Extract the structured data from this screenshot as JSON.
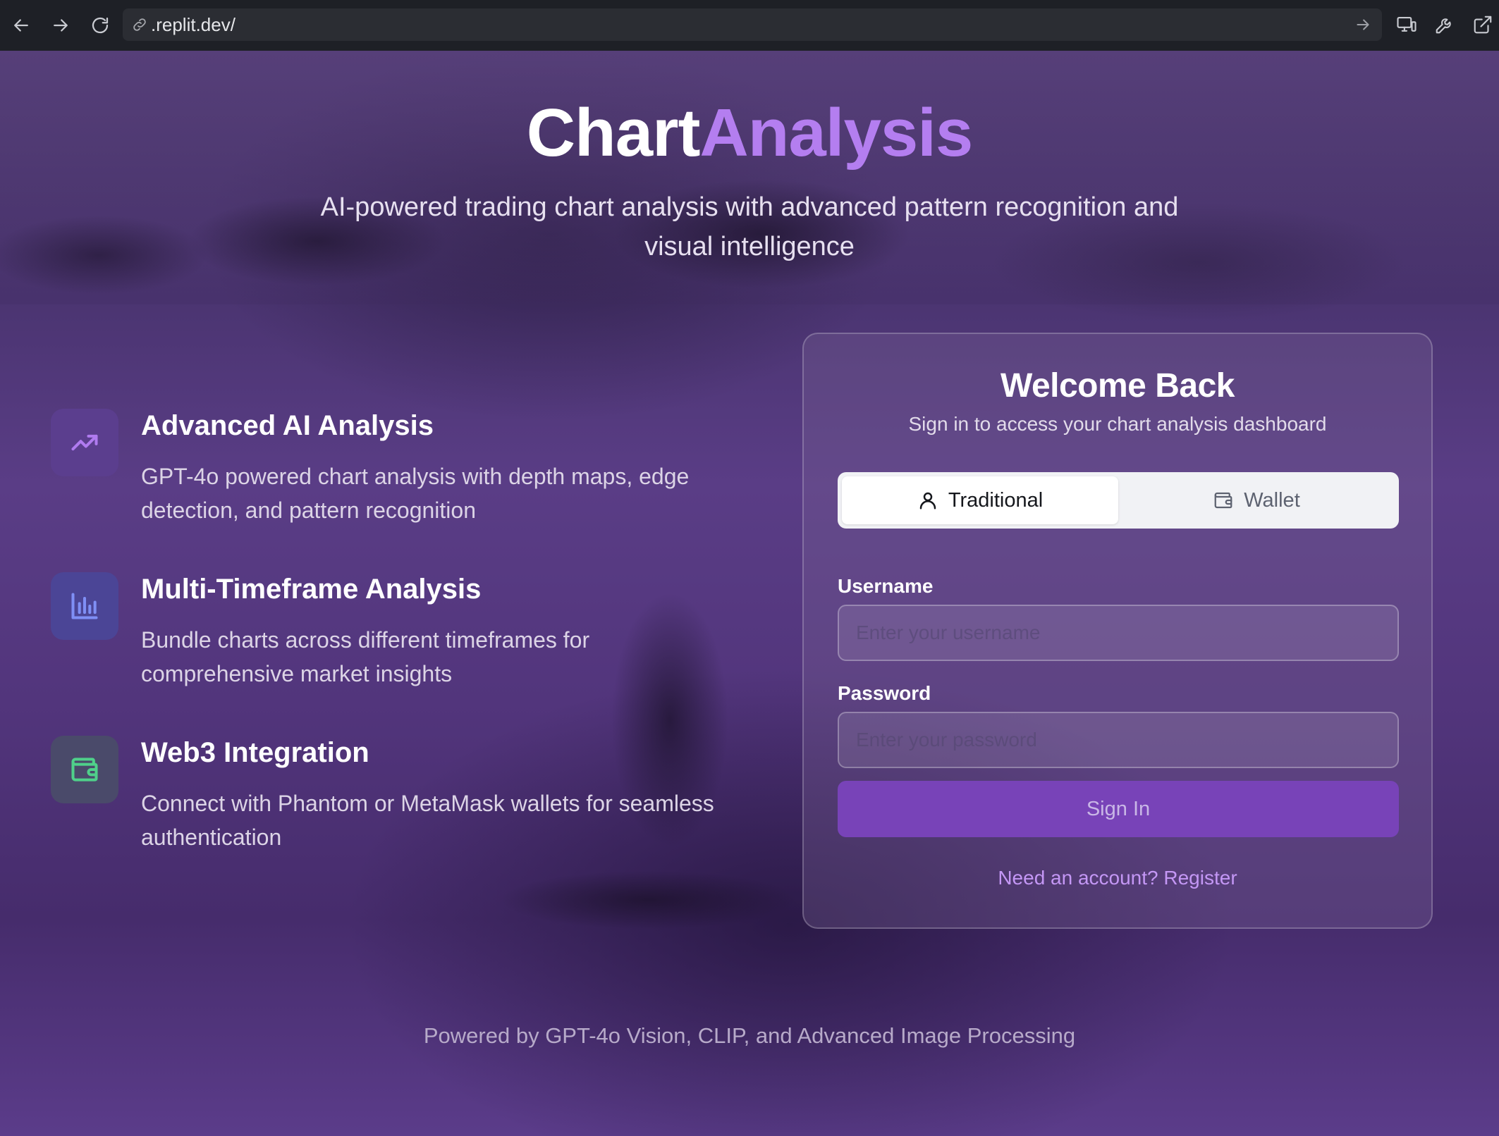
{
  "browser": {
    "url": ".replit.dev/"
  },
  "hero": {
    "title_part1": "Chart",
    "title_part2": "Analysis",
    "tagline": "AI-powered trading chart analysis with advanced pattern recognition and visual intelligence"
  },
  "features": [
    {
      "icon": "trending-up-icon",
      "title": "Advanced AI Analysis",
      "description": "GPT-4o powered chart analysis with depth maps, edge detection, and pattern recognition",
      "icon_color": "#b07bf0",
      "icon_bg": "#5b3e8e"
    },
    {
      "icon": "bar-chart-icon",
      "title": "Multi-Timeframe Analysis",
      "description": "Bundle charts across different timeframes for comprehensive market insights",
      "icon_color": "#7f8ff5",
      "icon_bg": "#4b4596"
    },
    {
      "icon": "wallet-icon",
      "title": "Web3 Integration",
      "description": "Connect with Phantom or MetaMask wallets for seamless authentication",
      "icon_color": "#4fd08a",
      "icon_bg": "#4a4a6a"
    }
  ],
  "login": {
    "title": "Welcome Back",
    "subtitle": "Sign in to access your chart analysis dashboard",
    "tabs": [
      {
        "label": "Traditional",
        "icon": "user-icon",
        "active": true
      },
      {
        "label": "Wallet",
        "icon": "wallet-icon",
        "active": false
      }
    ],
    "username_label": "Username",
    "username_placeholder": "Enter your username",
    "username_value": "",
    "password_label": "Password",
    "password_placeholder": "Enter your password",
    "password_value": "",
    "submit_label": "Sign In",
    "register_link": "Need an account? Register"
  },
  "footer": "Powered by GPT-4o Vision, CLIP, and Advanced Image Processing",
  "colors": {
    "accent": "#b47ef0",
    "button": "#7843b8",
    "link": "#c497f5"
  }
}
